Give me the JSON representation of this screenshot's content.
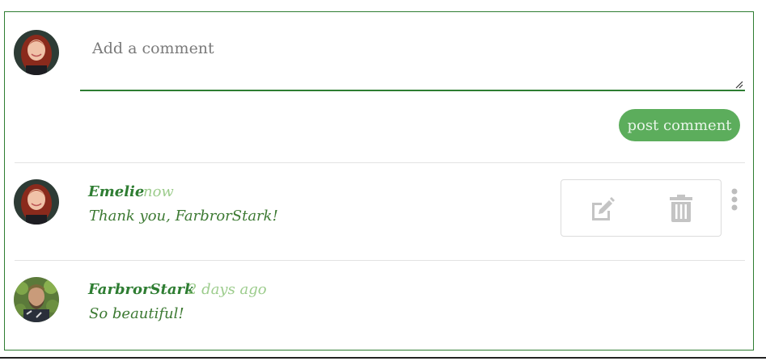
{
  "composer": {
    "placeholder": "Add a comment",
    "post_label": "post comment"
  },
  "comments": [
    {
      "author": "Emelie",
      "time": "now",
      "text": "Thank you, FarbrorStark!"
    },
    {
      "author": "FarbrorStark",
      "time": "2 days ago",
      "text": "So beautiful!"
    }
  ],
  "icons": {
    "edit": "edit-icon",
    "delete": "trash-icon",
    "more": "more-vertical-icon"
  },
  "colors": {
    "accent": "#2e7d32",
    "button": "#5cad5c",
    "time": "#9ccc8c",
    "icon_gray": "#c4c4c4"
  }
}
